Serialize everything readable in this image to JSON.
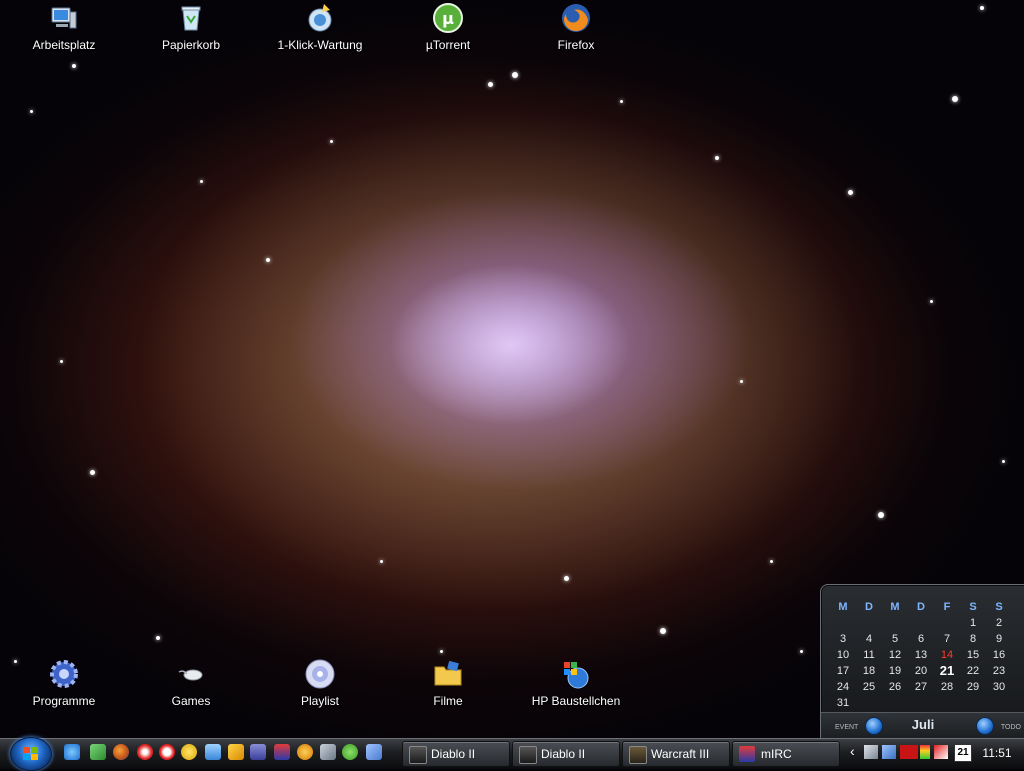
{
  "desktop": {
    "top_icons": [
      {
        "label": "Arbeitsplatz",
        "icon": "computer-icon"
      },
      {
        "label": "Papierkorb",
        "icon": "recycle-bin-icon"
      },
      {
        "label": "1-Klick-Wartung",
        "icon": "maintenance-icon"
      },
      {
        "label": "µTorrent",
        "icon": "utorrent-icon"
      },
      {
        "label": "Firefox",
        "icon": "firefox-icon"
      }
    ],
    "bottom_icons": [
      {
        "label": "Programme",
        "icon": "gear-icon"
      },
      {
        "label": "Games",
        "icon": "mouse-icon"
      },
      {
        "label": "Playlist",
        "icon": "cd-icon"
      },
      {
        "label": "Filme",
        "icon": "folder-icon"
      },
      {
        "label": "HP Baustellchen",
        "icon": "windows-globe-icon"
      }
    ]
  },
  "calendar": {
    "weekdays": [
      "M",
      "D",
      "M",
      "D",
      "F",
      "S",
      "S"
    ],
    "weeks": [
      [
        "",
        "",
        "",
        "",
        "",
        "1",
        "2"
      ],
      [
        "3",
        "4",
        "5",
        "6",
        "7",
        "8",
        "9"
      ],
      [
        "10",
        "11",
        "12",
        "13",
        "14",
        "15",
        "16"
      ],
      [
        "17",
        "18",
        "19",
        "20",
        "21",
        "22",
        "23"
      ],
      [
        "24",
        "25",
        "26",
        "27",
        "28",
        "29",
        "30"
      ],
      [
        "31",
        "",
        "",
        "",
        "",
        "",
        ""
      ]
    ],
    "highlight_day": "14",
    "today": "21",
    "month": "Juli",
    "event_label": "EVENT",
    "todo_label": "TODO",
    "highlight_color": "#ff3b2e"
  },
  "taskbar": {
    "start_icon": "windows-orb-icon",
    "quick_launch": [
      "ie-icon",
      "arrow-icon",
      "firefox-icon",
      "antivir-icon",
      "opera-icon",
      "norton-icon",
      "notepad-icon",
      "winamp-icon",
      "headphones-icon",
      "mirc-icon",
      "smiley-icon",
      "network-icon",
      "utorrent-icon",
      "tool-icon"
    ],
    "tasks": [
      {
        "label": "Diablo II",
        "icon": "diablo-icon"
      },
      {
        "label": "Diablo II",
        "icon": "diablo-icon"
      },
      {
        "label": "Warcraft III",
        "icon": "warcraft-icon"
      },
      {
        "label": "mIRC",
        "icon": "mirc-icon"
      }
    ],
    "tray": {
      "expand_arrow": "‹",
      "icons": [
        "network-icon",
        "tool-icon",
        "ati-icon",
        "meter-icon",
        "kaspersky-icon"
      ],
      "calendar_day": "21",
      "clock": "11:51"
    }
  }
}
